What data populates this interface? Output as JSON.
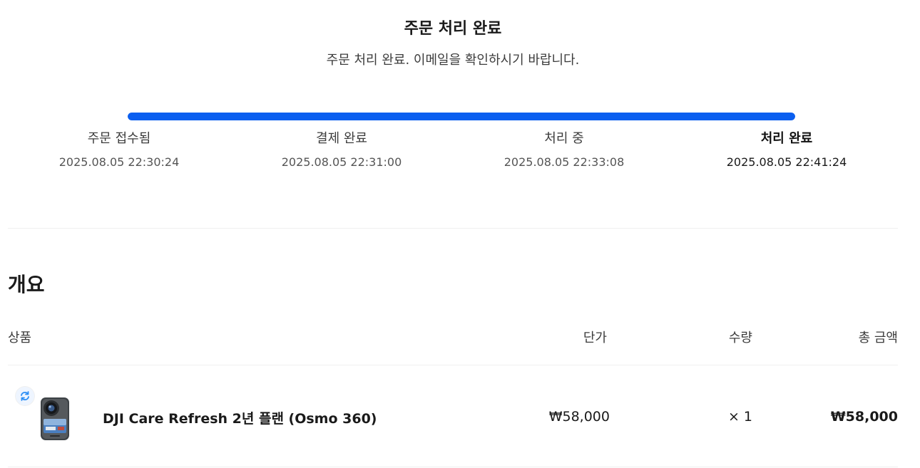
{
  "header": {
    "title": "주문 처리 완료",
    "subtitle": "주문 처리 완료. 이메일을 확인하시기 바랍니다."
  },
  "progress": {
    "fill_fraction": 1.0,
    "steps": [
      {
        "label": "주문 접수됨",
        "time": "2025.08.05 22:30:24"
      },
      {
        "label": "결제 완료",
        "time": "2025.08.05 22:31:00"
      },
      {
        "label": "처리 중",
        "time": "2025.08.05 22:33:08"
      },
      {
        "label": "처리 완료",
        "time": "2025.08.05 22:41:24"
      }
    ]
  },
  "summary": {
    "title": "개요",
    "columns": {
      "product": "상품",
      "unit_price": "단가",
      "quantity": "수량",
      "total": "총 금액"
    },
    "items": [
      {
        "name": "DJI Care Refresh 2년 플랜 (Osmo 360)",
        "unit_price": "₩58,000",
        "quantity": "× 1",
        "total": "₩58,000"
      }
    ]
  },
  "colors": {
    "accent": "#0b5ff0",
    "track": "#e6e6e6",
    "divider": "#efefef"
  },
  "icons": {
    "refresh": "refresh-icon",
    "product": "osmo-360-camera-image"
  }
}
